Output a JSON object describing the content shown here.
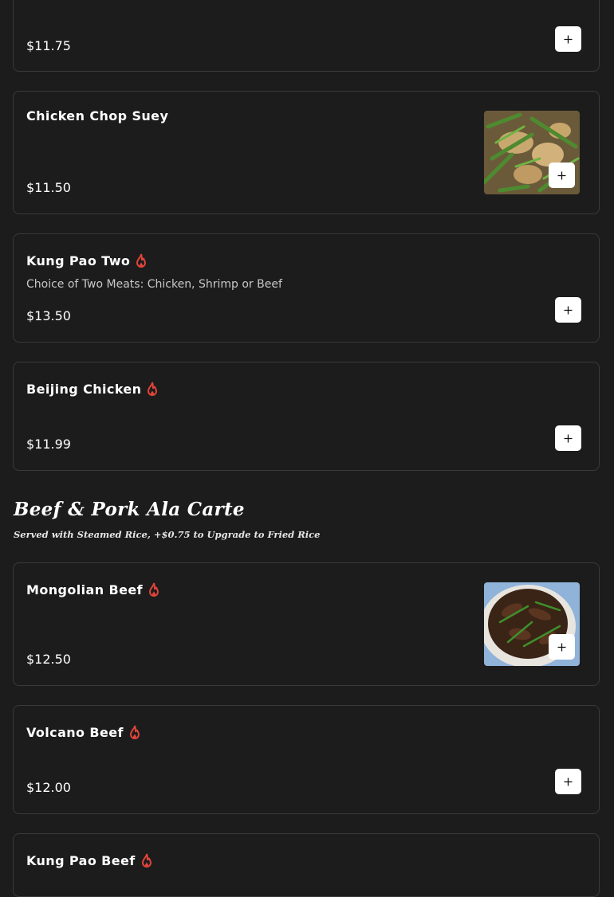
{
  "items": [
    {
      "name": "",
      "price": "$11.75",
      "spicy": false
    },
    {
      "name": "Chicken Chop Suey",
      "price": "$11.50",
      "spicy": false,
      "image": "chop-suey-photo"
    },
    {
      "name": "Kung Pao Two",
      "price": "$13.50",
      "spicy": true,
      "description": "Choice of Two Meats: Chicken, Shrimp or Beef"
    },
    {
      "name": "Beijing Chicken",
      "price": "$11.99",
      "spicy": true
    }
  ],
  "section": {
    "title": "Beef & Pork Ala Carte",
    "subtitle": "Served with Steamed Rice, +$0.75 to Upgrade to Fried Rice"
  },
  "beef_items": [
    {
      "name": "Mongolian Beef",
      "price": "$12.50",
      "spicy": true,
      "image": "mongolian-beef-photo"
    },
    {
      "name": "Volcano Beef",
      "price": "$12.00",
      "spicy": true
    },
    {
      "name": "Kung Pao Beef",
      "spicy": true
    }
  ],
  "icons": {
    "add": "plus-icon",
    "spicy": "flame-icon"
  },
  "colors": {
    "background": "#1c1c1c",
    "card_border": "#3a3a3a",
    "spicy": "#e0443a",
    "button": "#ffffff"
  }
}
